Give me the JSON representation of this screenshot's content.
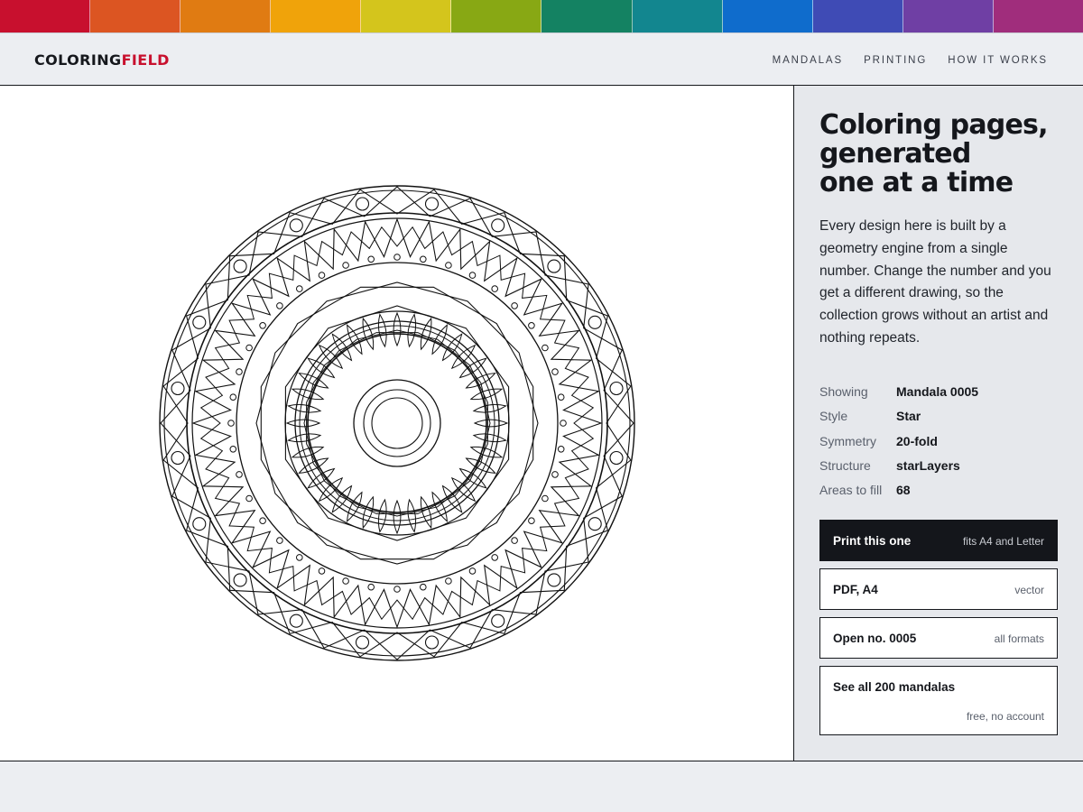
{
  "colors": {
    "stripe": [
      "#c8102e",
      "#dc5522",
      "#e07b12",
      "#f0a30a",
      "#d4c51c",
      "#88a814",
      "#148262",
      "#12868f",
      "#0f6ccc",
      "#3f4bb5",
      "#6f3fa4",
      "#a02d7c"
    ],
    "brand_accent": "#c8102e",
    "ink": "#15171c"
  },
  "brand": {
    "part1": "COLORING",
    "part2": "FIELD"
  },
  "nav": {
    "items": [
      "MANDALAS",
      "PRINTING",
      "HOW IT WORKS"
    ]
  },
  "hero": {
    "title_lines": [
      "Coloring pages,",
      "generated",
      "one at a time"
    ],
    "description": "Every design here is built by a geometry engine from a single number. Change the number and you get a different drawing, so the collection grows without an artist and nothing repeats."
  },
  "details": [
    {
      "label": "Showing",
      "value": "Mandala 0005"
    },
    {
      "label": "Style",
      "value": "Star"
    },
    {
      "label": "Symmetry",
      "value": "20-fold"
    },
    {
      "label": "Structure",
      "value": "starLayers"
    },
    {
      "label": "Areas to fill",
      "value": "68"
    }
  ],
  "actions": {
    "print": {
      "label": "Print this one",
      "note": "fits A4 and Letter"
    },
    "pdf": {
      "label": "PDF, A4",
      "note": "vector"
    },
    "open": {
      "label": "Open no. 0005",
      "note": "all formats"
    },
    "all": {
      "label": "See all 200 mandalas",
      "note": "free, no account"
    }
  },
  "mandala": {
    "symmetry": 20
  }
}
